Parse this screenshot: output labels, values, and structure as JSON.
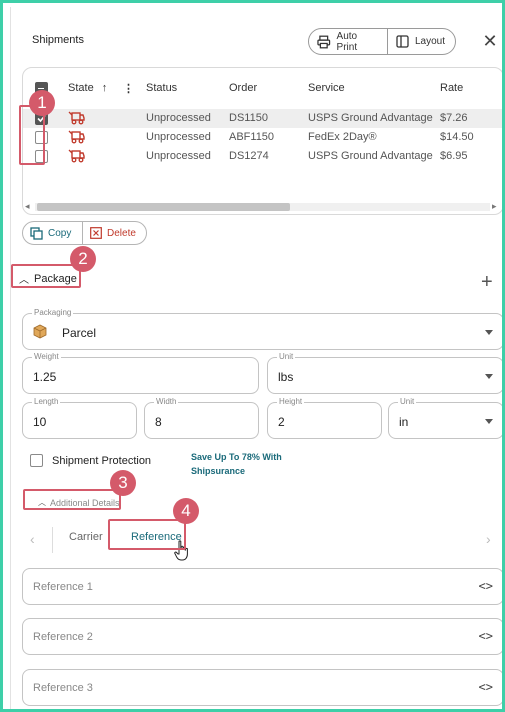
{
  "header": {
    "title": "Shipments",
    "auto_print_label": "Auto Print",
    "layout_label": "Layout"
  },
  "table": {
    "columns": [
      "State",
      "Status",
      "Order",
      "Service",
      "Rate"
    ],
    "rows": [
      {
        "selected": true,
        "status": "Unprocessed",
        "order": "DS1150",
        "service": "USPS Ground Advantage",
        "rate": "$7.26"
      },
      {
        "selected": false,
        "status": "Unprocessed",
        "order": "ABF1150",
        "service": "FedEx 2Day®",
        "rate": "$14.50"
      },
      {
        "selected": false,
        "status": "Unprocessed",
        "order": "DS1274",
        "service": "USPS Ground Advantage",
        "rate": "$6.95"
      }
    ]
  },
  "actions": {
    "copy_label": "Copy",
    "delete_label": "Delete"
  },
  "package": {
    "section_title": "Package",
    "packaging_label": "Packaging",
    "packaging_value": "Parcel",
    "weight_label": "Weight",
    "weight_value": "1.25",
    "weight_unit_label": "Unit",
    "weight_unit_value": "lbs",
    "length_label": "Length",
    "length_value": "10",
    "width_label": "Width",
    "width_value": "8",
    "height_label": "Height",
    "height_value": "2",
    "dim_unit_label": "Unit",
    "dim_unit_value": "in"
  },
  "protection": {
    "label": "Shipment Protection",
    "promo_line1": "Save Up To 78% With",
    "promo_line2": "Shipsurance"
  },
  "additional_details": {
    "title": "Additional Details",
    "tabs": [
      "Carrier",
      "Reference"
    ],
    "active_tab": "Reference",
    "references": [
      "Reference 1",
      "Reference 2",
      "Reference 3"
    ]
  },
  "annotations": {
    "badges": [
      "1",
      "2",
      "3",
      "4"
    ],
    "color": "#d45a6a"
  },
  "colors": {
    "background": "#3ecfa8",
    "accent_teal": "#1a6a7a",
    "delete_red": "#c0392b",
    "truck_red": "#c0392b"
  }
}
